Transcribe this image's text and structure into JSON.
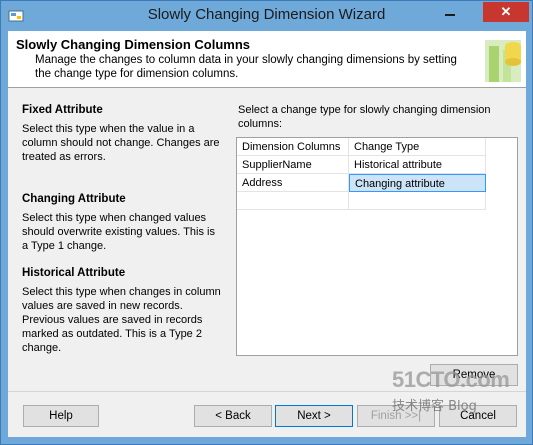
{
  "window": {
    "title": "Slowly Changing Dimension Wizard",
    "close_glyph": "✕",
    "colors": {
      "titlebar": "#6fa9d9",
      "close": "#c7372f"
    }
  },
  "header": {
    "title": "Slowly Changing Dimension Columns",
    "description": "Manage the changes to column data in your slowly changing dimensions by setting the change type for dimension columns."
  },
  "help": {
    "fixed": {
      "title": "Fixed Attribute",
      "text": "Select this type when the value in a column should not change. Changes are treated as errors."
    },
    "changing": {
      "title": "Changing Attribute",
      "text": "Select this type when changed values should overwrite existing values. This is a Type 1 change."
    },
    "historical": {
      "title": "Historical Attribute",
      "text": "Select this type when changes in column values are saved in new records. Previous values are saved in records marked as outdated. This is a Type 2 change."
    }
  },
  "grid": {
    "instruction": "Select a change type for slowly changing dimension columns:",
    "columns": [
      "Dimension Columns",
      "Change Type"
    ],
    "rows": [
      {
        "column": "SupplierName",
        "change_type": "Historical attribute"
      },
      {
        "column": "Address",
        "change_type": "Changing attribute"
      }
    ]
  },
  "buttons": {
    "remove": "Remove",
    "help": "Help",
    "back": "< Back",
    "next": "Next >",
    "finish": "Finish >>|",
    "cancel": "Cancel"
  },
  "watermark": {
    "site": "51CTO.com",
    "sub": "技术博客 Blog"
  }
}
